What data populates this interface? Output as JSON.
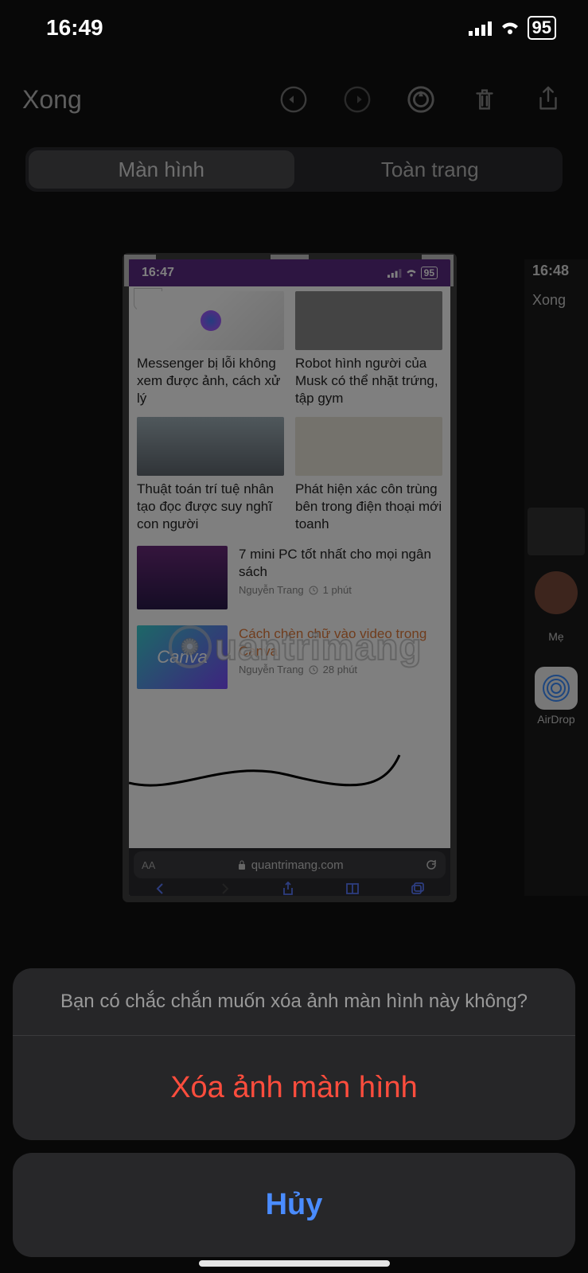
{
  "status_bar": {
    "time": "16:49",
    "battery": "95"
  },
  "toolbar": {
    "done": "Xong"
  },
  "segmented": {
    "screen": "Màn hình",
    "full_page": "Toàn trang"
  },
  "preview": {
    "inner_status": {
      "time": "16:47",
      "battery": "95"
    },
    "card1_title": "Messenger bị lỗi không xem được ảnh, cách xử lý",
    "card2_title": "Robot hình người của Musk có thể nhặt trứng, tập gym",
    "card3_title": "Thuật toán trí tuệ nhân tạo đọc được suy nghĩ con người",
    "card4_title": "Phát hiện xác côn trùng bên trong điện thoại mới toanh",
    "list1_title": "7 mini PC tốt nhất cho mọi ngân sách",
    "list1_author": "Nguyễn Trang",
    "list1_time": "1 phút",
    "list2_title": "Cách chèn chữ vào video trong Canva",
    "list2_author": "Nguyễn Trang",
    "list2_time": "28 phút",
    "canva_label": "Canva",
    "url": "quantrimang.com",
    "aa": "AA"
  },
  "watermark": "uantrimang",
  "side": {
    "time": "16:48",
    "done": "Xong",
    "contact": "Mẹ",
    "airdrop": "AirDrop"
  },
  "sheet": {
    "message": "Bạn có chắc chắn muốn xóa ảnh màn hình này không?",
    "delete": "Xóa ảnh màn hình",
    "cancel": "Hủy"
  }
}
